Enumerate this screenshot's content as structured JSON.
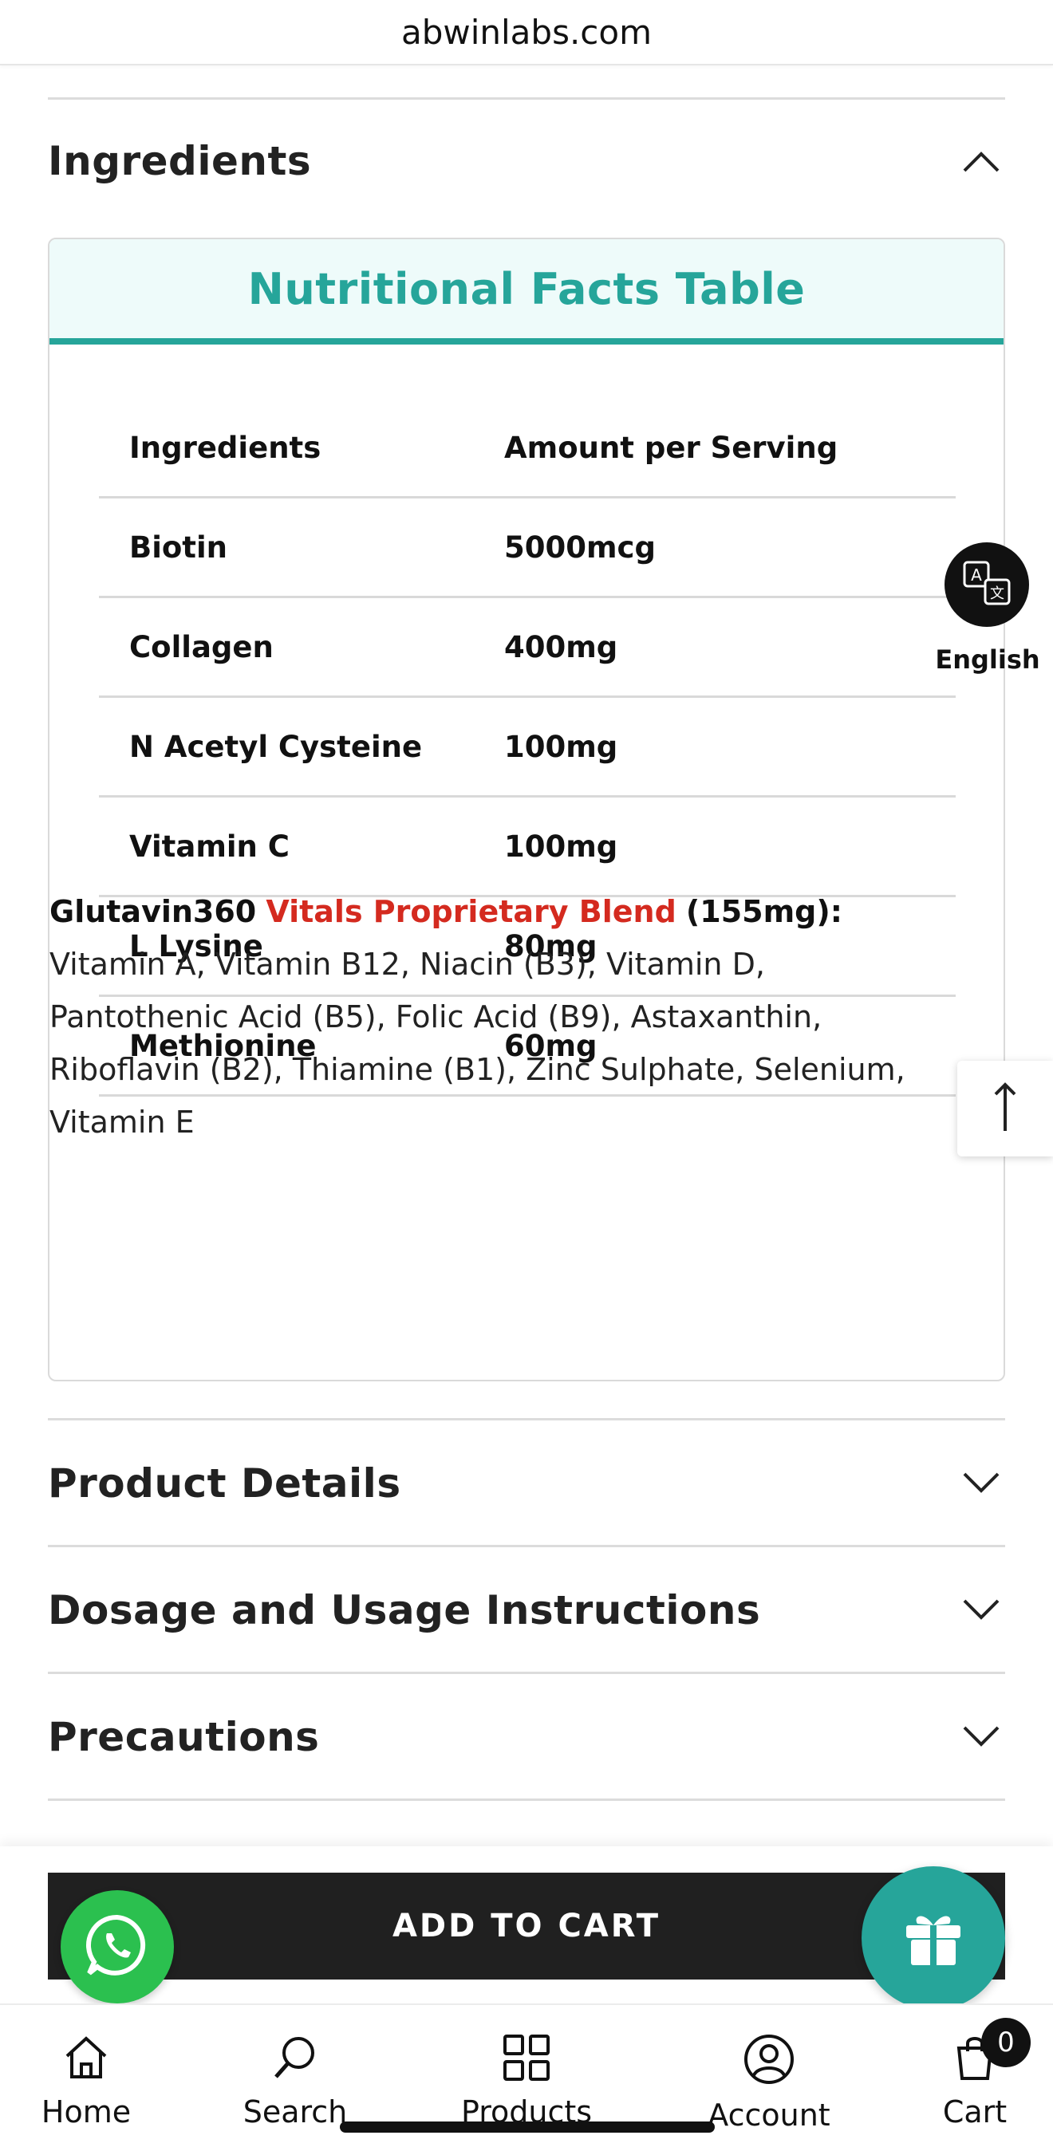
{
  "browser": {
    "url": "abwinlabs.com"
  },
  "accordion": {
    "ingredients_title": "Ingredients",
    "product_details_title": "Product Details",
    "dosage_title": "Dosage and Usage Instructions",
    "precautions_title": "Precautions"
  },
  "nutrition": {
    "title": "Nutritional Facts Table",
    "header": {
      "ingredient": "Ingredients",
      "amount": "Amount per Serving"
    },
    "rows": [
      {
        "name": "Biotin",
        "amount": "5000mcg"
      },
      {
        "name": "Collagen",
        "amount": "400mg"
      },
      {
        "name": "N Acetyl Cysteine",
        "amount": "100mg"
      },
      {
        "name": "Vitamin C",
        "amount": "100mg"
      },
      {
        "name": "L Lysine",
        "amount": "80mg"
      },
      {
        "name": "Methionine",
        "amount": "60mg"
      }
    ],
    "blend": {
      "brand": "Glutavin360",
      "name": "Vitals Proprietary Blend",
      "amount": "(155mg):",
      "text": "Vitamin A, Vitamin B12, Niacin (B3), Vitamin D, Pantothenic Acid (B5), Folic Acid (B9), Astaxanthin, Riboflavin (B2), Thiamine (B1), Zinc Sulphate, Selenium, Vitamin E"
    }
  },
  "translate": {
    "label": "English",
    "icon": "translate-icon"
  },
  "cart": {
    "add_to_cart": "ADD TO CART",
    "count": "0"
  },
  "bottom_nav": [
    {
      "label": "Home",
      "icon": "home-icon"
    },
    {
      "label": "Search",
      "icon": "search-icon"
    },
    {
      "label": "Products",
      "icon": "grid-icon"
    },
    {
      "label": "Account",
      "icon": "account-icon"
    },
    {
      "label": "Cart",
      "icon": "cart-icon"
    }
  ],
  "colors": {
    "accent": "#26a59a",
    "blend_red": "#d42a1f",
    "whatsapp": "#2bc04f",
    "dark": "#202020"
  }
}
